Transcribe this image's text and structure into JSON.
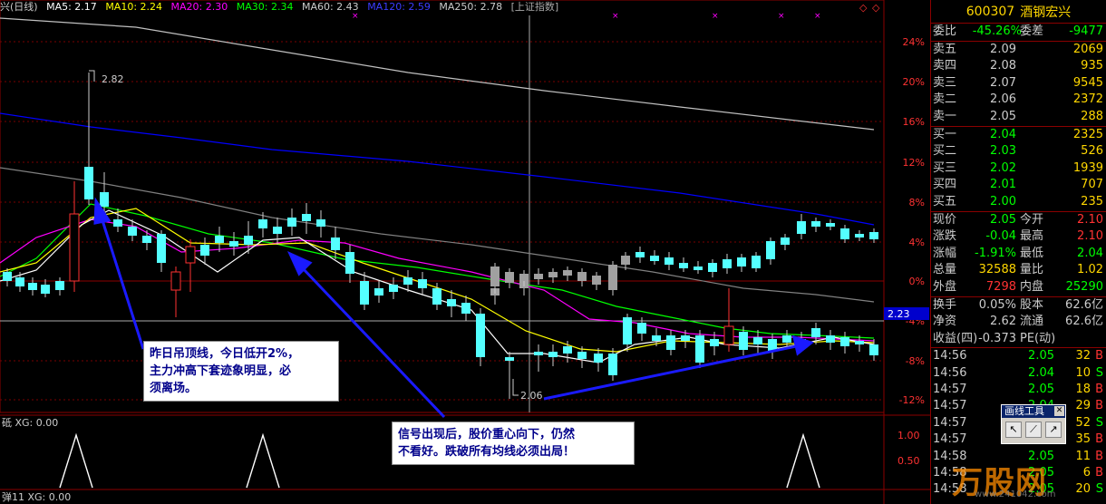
{
  "header": {
    "name": "兴(日线)",
    "ma5": "MA5: 2.17",
    "ma10": "MA10: 2.24",
    "ma20": "MA20: 2.30",
    "ma30": "MA30: 2.34",
    "ma60": "MA60: 2.43",
    "ma120": "MA120: 2.59",
    "ma250": "MA250: 2.78",
    "index": "[上证指数]"
  },
  "colors": {
    "ma5": "#ffffff",
    "ma10": "#ffff00",
    "ma20": "#ff00ff",
    "ma30": "#00ff00",
    "ma60": "#808080",
    "ma120": "#0000ff",
    "ma250": "#c0c0c0",
    "up": "#ff3232",
    "down": "#54ffff"
  },
  "axis": {
    "pct_labels": [
      "24%",
      "20%",
      "16%",
      "12%",
      "8%",
      "4%",
      "0%",
      "-4%",
      "-8%",
      "-12%"
    ],
    "current_price": "2.23",
    "sub_labels": [
      "1.00",
      "0.50"
    ]
  },
  "chart_annotations": {
    "high": "2.82",
    "low": "2.06"
  },
  "indicator1": {
    "label": "砥 XG: 0.00"
  },
  "indicator2": {
    "label": "弹11 XG: 0.00"
  },
  "notes": {
    "note1": [
      "昨日吊顶线，今日低开2%，",
      "主力冲高下套迹象明显，必",
      "须离场。"
    ],
    "note2": [
      "信号出现后，股价重心向下，仍然",
      "不看好。跌破所有均线必须出局！"
    ]
  },
  "quote": {
    "code": "600307",
    "name": "酒钢宏兴",
    "wei_bi_label": "委比",
    "wei_bi": "-45.26%",
    "wei_cha_label": "委差",
    "wei_cha": "-9477",
    "sells": [
      {
        "label": "卖五",
        "price": "2.09",
        "vol": "2069"
      },
      {
        "label": "卖四",
        "price": "2.08",
        "vol": "935"
      },
      {
        "label": "卖三",
        "price": "2.07",
        "vol": "9545"
      },
      {
        "label": "卖二",
        "price": "2.06",
        "vol": "2372"
      },
      {
        "label": "卖一",
        "price": "2.05",
        "vol": "288"
      }
    ],
    "buys": [
      {
        "label": "买一",
        "price": "2.04",
        "vol": "2325"
      },
      {
        "label": "买二",
        "price": "2.03",
        "vol": "526"
      },
      {
        "label": "买三",
        "price": "2.02",
        "vol": "1939"
      },
      {
        "label": "买四",
        "price": "2.01",
        "vol": "707"
      },
      {
        "label": "买五",
        "price": "2.00",
        "vol": "235"
      }
    ],
    "stats": [
      {
        "l1": "现价",
        "v1": "2.05",
        "c1": "#00ff00",
        "l2": "今开",
        "v2": "2.10",
        "c2": "#ff3232"
      },
      {
        "l1": "涨跌",
        "v1": "-0.04",
        "c1": "#00ff00",
        "l2": "最高",
        "v2": "2.10",
        "c2": "#ff3232"
      },
      {
        "l1": "涨幅",
        "v1": "-1.91%",
        "c1": "#00ff00",
        "l2": "最低",
        "v2": "2.04",
        "c2": "#00ff00"
      },
      {
        "l1": "总量",
        "v1": "32588",
        "c1": "#ffd700",
        "l2": "量比",
        "v2": "1.02",
        "c2": "#ffd700"
      },
      {
        "l1": "外盘",
        "v1": "7298",
        "c1": "#ff3232",
        "l2": "内盘",
        "v2": "25290",
        "c2": "#00ff00"
      }
    ],
    "stats2": [
      {
        "l1": "换手",
        "v1": "0.05%",
        "l2": "股本",
        "v2": "62.6亿"
      },
      {
        "l1": "净资",
        "v1": "2.62",
        "l2": "流通",
        "v2": "62.6亿"
      },
      {
        "l1": "收益(四)",
        "v1": "-0.373",
        "l2": "PE(动)",
        "v2": ""
      }
    ],
    "ticks": [
      {
        "t": "14:56",
        "p": "2.05",
        "q": "32",
        "d": "B",
        "pc": "#00ff00",
        "dc": "#ff3232"
      },
      {
        "t": "14:56",
        "p": "2.04",
        "q": "10",
        "d": "S",
        "pc": "#00ff00",
        "dc": "#00ff00"
      },
      {
        "t": "14:57",
        "p": "2.05",
        "q": "18",
        "d": "B",
        "pc": "#00ff00",
        "dc": "#ff3232"
      },
      {
        "t": "14:57",
        "p": "2.04",
        "q": "29",
        "d": "B",
        "pc": "#00ff00",
        "dc": "#ff3232"
      },
      {
        "t": "14:57",
        "p": "2.04",
        "q": "52",
        "d": "S",
        "pc": "#00ff00",
        "dc": "#00ff00"
      },
      {
        "t": "14:57",
        "p": "2.05",
        "q": "35",
        "d": "B",
        "pc": "#00ff00",
        "dc": "#ff3232"
      },
      {
        "t": "14:58",
        "p": "2.05",
        "q": "11",
        "d": "B",
        "pc": "#00ff00",
        "dc": "#ff3232"
      },
      {
        "t": "14:58",
        "p": "2.05",
        "q": "6",
        "d": "B",
        "pc": "#00ff00",
        "dc": "#ff3232"
      },
      {
        "t": "14:58",
        "p": "2.05",
        "q": "20",
        "d": "S",
        "pc": "#00ff00",
        "dc": "#00ff00"
      }
    ]
  },
  "toolbox": {
    "title": "画线工具",
    "close": "✕"
  },
  "watermark": {
    "text": "万股网",
    "url": "www.241042.com"
  }
}
